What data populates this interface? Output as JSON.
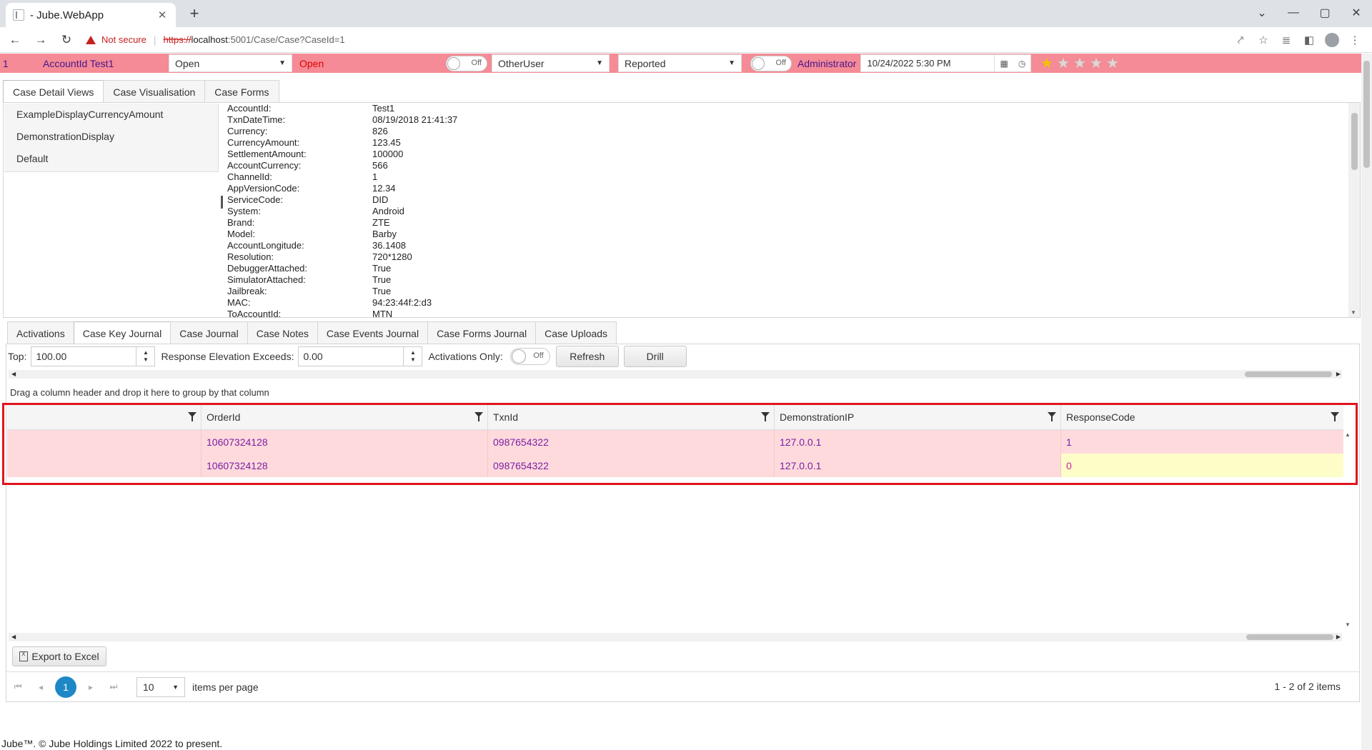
{
  "browser": {
    "tab_title": "- Jube.WebApp",
    "not_secure": "Not secure",
    "url_scheme": "https://",
    "url_host": "localhost",
    "url_path": ":5001/Case/Case?CaseId=1"
  },
  "case_header": {
    "case_id": "1",
    "account": "AccountId  Test1",
    "status_select": "Open",
    "status_text": "Open",
    "lock_toggle": "Off",
    "user_select": "OtherUser",
    "state_select": "Reported",
    "diary_toggle": "Off",
    "owner": "Administrator",
    "date": "10/24/2022 5:30 PM",
    "rating": 1,
    "rating_max": 5,
    "colors": {
      "banner": "#f48b96",
      "star_on": "#f2c200"
    }
  },
  "upper_tabs": [
    {
      "label": "Case Detail Views"
    },
    {
      "label": "Case Visualisation"
    },
    {
      "label": "Case Forms"
    }
  ],
  "views": [
    {
      "label": "ExampleDisplayCurrencyAmount"
    },
    {
      "label": "DemonstrationDisplay"
    },
    {
      "label": "Default"
    }
  ],
  "details": [
    {
      "key": "AccountId:",
      "value": "Test1"
    },
    {
      "key": "TxnDateTime:",
      "value": "08/19/2018 21:41:37"
    },
    {
      "key": "Currency:",
      "value": "826"
    },
    {
      "key": "CurrencyAmount:",
      "value": "123.45"
    },
    {
      "key": "SettlementAmount:",
      "value": "100000"
    },
    {
      "key": "AccountCurrency:",
      "value": "566"
    },
    {
      "key": "ChannelId:",
      "value": "1"
    },
    {
      "key": "AppVersionCode:",
      "value": "12.34"
    },
    {
      "key": "ServiceCode:",
      "value": "DID"
    },
    {
      "key": "System:",
      "value": "Android"
    },
    {
      "key": "Brand:",
      "value": "ZTE"
    },
    {
      "key": "Model:",
      "value": "Barby"
    },
    {
      "key": "AccountLongitude:",
      "value": "36.1408"
    },
    {
      "key": "Resolution:",
      "value": "720*1280"
    },
    {
      "key": "DebuggerAttached:",
      "value": "True"
    },
    {
      "key": "SimulatorAttached:",
      "value": "True"
    },
    {
      "key": "Jailbreak:",
      "value": "True"
    },
    {
      "key": "MAC:",
      "value": "94:23:44f:2:d3"
    },
    {
      "key": "ToAccountId:",
      "value": "MTN"
    }
  ],
  "lower_tabs": [
    {
      "label": "Activations"
    },
    {
      "label": "Case Key Journal"
    },
    {
      "label": "Case Journal"
    },
    {
      "label": "Case Notes"
    },
    {
      "label": "Case Events Journal"
    },
    {
      "label": "Case Forms Journal"
    },
    {
      "label": "Case Uploads"
    }
  ],
  "toolbar": {
    "top_label": "Top:",
    "top_value": "100.00",
    "elevation_label": "Response Elevation Exceeds:",
    "elevation_value": "0.00",
    "activations_label": "Activations Only:",
    "activations_toggle": "Off",
    "refresh_label": "Refresh",
    "drill_label": "Drill"
  },
  "grid": {
    "group_hint": "Drag a column header and drop it here to group by that column",
    "columns": [
      "",
      "OrderId",
      "TxnId",
      "DemonstrationIP",
      "ResponseCode"
    ],
    "rows": [
      [
        "",
        "10607324128",
        "0987654322",
        "127.0.0.1",
        "1"
      ],
      [
        "",
        "10607324128",
        "0987654322",
        "127.0.0.1",
        "0"
      ]
    ],
    "colors": {
      "row": "#fedadd",
      "highlight_cell": "#fdfdc8",
      "selection_box": "#e0141e"
    }
  },
  "export_label": "Export to Excel",
  "pager": {
    "current_page": "1",
    "page_size": "10",
    "items_per_page": "items per page",
    "info": "1 - 2 of 2 items"
  },
  "footer": "Jube™. © Jube Holdings Limited 2022 to present."
}
